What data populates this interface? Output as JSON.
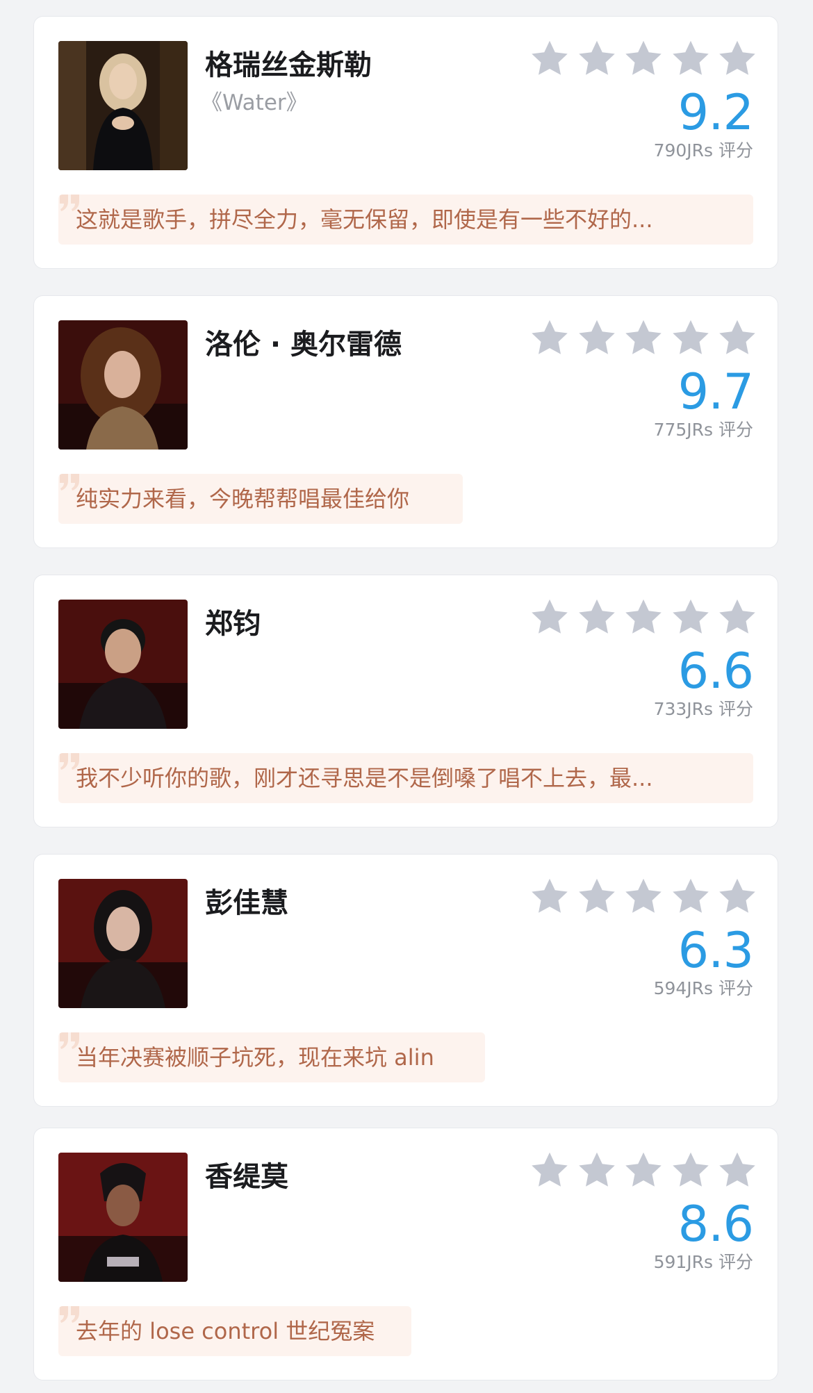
{
  "colors": {
    "score": "#2b9be3",
    "star_empty": "#c4c8d2",
    "comment_bg": "#fdf3ee",
    "comment_text": "#b0674a"
  },
  "items": [
    {
      "name": "格瑞丝金斯勒",
      "song": "《Water》",
      "stars_filled": 0,
      "score": "9.2",
      "votes": "790JRs 评分",
      "comment": "这就是歌手，拼尽全力，毫无保留，即使是有一些不好的..."
    },
    {
      "name": "洛伦 · 奥尔雷德",
      "song": "",
      "stars_filled": 0,
      "score": "9.7",
      "votes": "775JRs 评分",
      "comment": "纯实力来看，今晚帮帮唱最佳给你"
    },
    {
      "name": "郑钧",
      "song": "",
      "stars_filled": 0,
      "score": "6.6",
      "votes": "733JRs 评分",
      "comment": "我不少听你的歌，刚才还寻思是不是倒嗓了唱不上去，最..."
    },
    {
      "name": "彭佳慧",
      "song": "",
      "stars_filled": 0,
      "score": "6.3",
      "votes": "594JRs 评分",
      "comment": "当年决赛被顺子坑死，现在来坑 alin"
    },
    {
      "name": "香缇莫",
      "song": "",
      "stars_filled": 0,
      "score": "8.6",
      "votes": "591JRs 评分",
      "comment": "去年的 lose control 世纪冤案"
    }
  ]
}
